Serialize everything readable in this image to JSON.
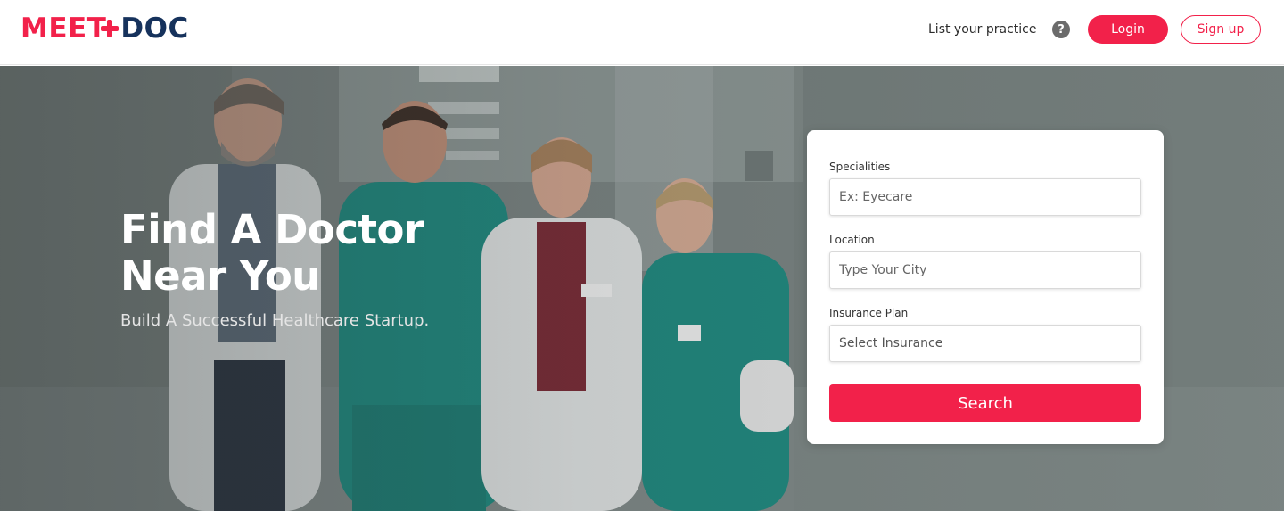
{
  "header": {
    "logo_part1": "MEET",
    "logo_part2": "DOC",
    "list_practice": "List your practice",
    "help_icon_glyph": "?",
    "login_label": "Login",
    "signup_label": "Sign up"
  },
  "hero": {
    "title_line1": "Find A Doctor",
    "title_line2": "Near You",
    "subtitle": "Build A Successful Healthcare Startup."
  },
  "search_form": {
    "specialities_label": "Specialities",
    "specialities_placeholder": "Ex: Eyecare",
    "location_label": "Location",
    "location_placeholder": "Type Your City",
    "insurance_label": "Insurance Plan",
    "insurance_value": "Select Insurance",
    "search_label": "Search"
  },
  "colors": {
    "brand_red": "#f2214a",
    "brand_navy": "#16325c"
  },
  "icons": [
    "medical-cross-icon",
    "help-icon"
  ]
}
